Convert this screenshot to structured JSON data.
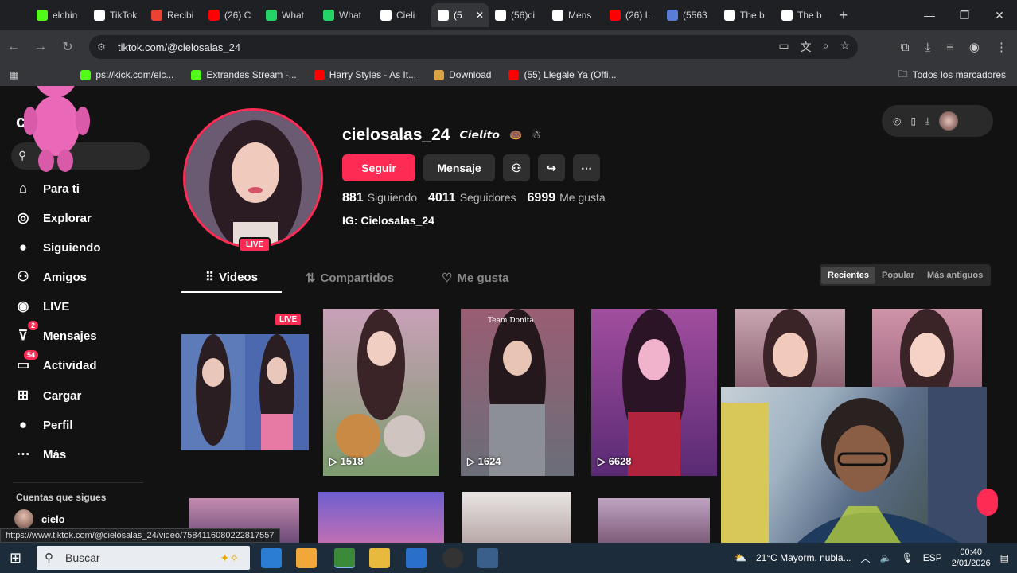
{
  "browser": {
    "tabs": [
      {
        "label": "elchin",
        "icon": "kick-icon",
        "color": "#53fc18"
      },
      {
        "label": "TikTok",
        "icon": "tiktok-icon",
        "color": "#ffffff"
      },
      {
        "label": "Recibi",
        "icon": "gmail-icon",
        "color": "#ea4335"
      },
      {
        "label": "(26) C",
        "icon": "youtube-icon",
        "color": "#ff0000"
      },
      {
        "label": "What",
        "icon": "whatsapp-icon",
        "color": "#25d366"
      },
      {
        "label": "What",
        "icon": "whatsapp-icon",
        "color": "#25d366"
      },
      {
        "label": "Cieli",
        "icon": "tiktok-icon",
        "color": "#ffffff"
      },
      {
        "label": "(5",
        "icon": "tiktok-icon",
        "color": "#ffffff",
        "active": true
      },
      {
        "label": "(56)ci",
        "icon": "tiktok-icon",
        "color": "#ffffff"
      },
      {
        "label": "Mens",
        "icon": "tiktok-icon",
        "color": "#ffffff"
      },
      {
        "label": "(26) L",
        "icon": "youtube-icon",
        "color": "#ff0000"
      },
      {
        "label": "(5563",
        "icon": "app-icon",
        "color": "#5a7bd6"
      },
      {
        "label": "The b",
        "icon": "site-icon",
        "color": "#ffffff"
      },
      {
        "label": "The b",
        "icon": "site-icon",
        "color": "#ffffff"
      }
    ],
    "url": "tiktok.com/@cielosalas_24",
    "bookmarks": [
      {
        "label": "ps://kick.com/elc...",
        "color": "#53fc18"
      },
      {
        "label": "Extrandes Stream -...",
        "color": "#53fc18"
      },
      {
        "label": "Harry Styles - As It...",
        "color": "#ff0000"
      },
      {
        "label": "Download",
        "color": "#d9a441"
      },
      {
        "label": "(55) Llegale Ya (Offi...",
        "color": "#ff0000"
      }
    ],
    "all_bookmarks": "Todos los marcadores"
  },
  "sidebar": {
    "logo": "c        k",
    "nav": [
      {
        "label": "Para ti",
        "icon": "home-icon"
      },
      {
        "label": "Explorar",
        "icon": "compass-icon"
      },
      {
        "label": "Siguiendo",
        "icon": "following-avatar-icon"
      },
      {
        "label": "Amigos",
        "icon": "friends-icon"
      },
      {
        "label": "LIVE",
        "icon": "live-icon"
      },
      {
        "label": "Mensajes",
        "icon": "messages-icon",
        "badge": "2"
      },
      {
        "label": "Actividad",
        "icon": "activity-icon",
        "badge": "54"
      },
      {
        "label": "Cargar",
        "icon": "upload-icon"
      },
      {
        "label": "Perfil",
        "icon": "profile-icon"
      },
      {
        "label": "Más",
        "icon": "more-icon"
      }
    ],
    "following_header": "Cuentas que sigues",
    "following_name": "cielo"
  },
  "profile": {
    "username": "cielosalas_24",
    "nickname": "𝘾𝙞𝙚𝙡𝙞𝙩𝙤",
    "follow_label": "Seguir",
    "message_label": "Mensaje",
    "live_tag": "LIVE",
    "following_count": "881",
    "following_label": "Siguiendo",
    "followers_count": "4011",
    "followers_label": "Seguidores",
    "likes_count": "6999",
    "likes_label": "Me gusta",
    "bio": "IG: Cielosalas_24"
  },
  "tabs": {
    "videos": "Videos",
    "reposts": "Compartidos",
    "liked": "Me gusta"
  },
  "sort": {
    "recent": "Recientes",
    "popular": "Popular",
    "oldest": "Más antiguos"
  },
  "videos": [
    {
      "views": "",
      "live": "LIVE"
    },
    {
      "views": "1518"
    },
    {
      "views": "1624",
      "caption": "Team Donita"
    },
    {
      "views": "6628"
    },
    {
      "views": ""
    },
    {
      "views": ""
    }
  ],
  "status_url": "https://www.tiktok.com/@cielosalas_24/video/7584116080222817557",
  "taskbar": {
    "search_placeholder": "Buscar",
    "weather": "21°C  Mayorm. nubla...",
    "lang": "ESP",
    "time": "00:40",
    "date": "2/01/2026"
  }
}
